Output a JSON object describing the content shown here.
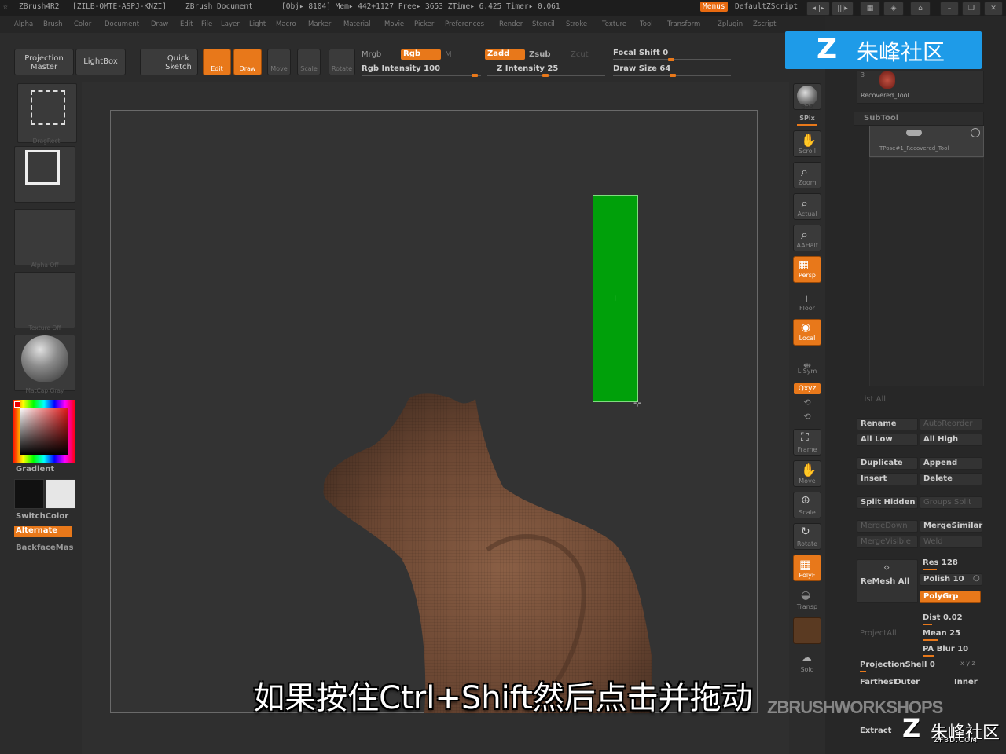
{
  "titlebar": {
    "app": "ZBrush4R2",
    "serial": "[ZILB-OMTE-ASPJ-KNZI]",
    "doc": "ZBrush Document",
    "stats": "[Obj▸ 8104] Mem▸ 442+1127  Free▸ 3653  ZTime▸ 6.425  Timer▸ 0.061",
    "menus_btn": "Menus",
    "script": "DefaultZScript"
  },
  "menubar": [
    "Alpha",
    "Brush",
    "Color",
    "Document",
    "Draw",
    "Edit",
    "File",
    "Layer",
    "Light",
    "Macro",
    "Marker",
    "Material",
    "Movie",
    "Picker",
    "Preferences",
    "Render",
    "Stencil",
    "Stroke",
    "Texture",
    "Tool",
    "Transform",
    "Zplugin",
    "Zscript"
  ],
  "toolbar": {
    "projection_master": [
      "Projection",
      "Master"
    ],
    "lightbox": "LightBox",
    "quick_sketch": [
      "Quick",
      "Sketch"
    ],
    "edit": "Edit",
    "draw": "Draw",
    "move": "Move",
    "scale": "Scale",
    "rotate": "Rotate",
    "mrgb": "Mrgb",
    "rgb": "Rgb",
    "m": "M",
    "rgb_intensity": "Rgb Intensity 100",
    "zadd": "Zadd",
    "zsub": "Zsub",
    "zcut": "Zcut",
    "z_intensity": "Z Intensity 25",
    "focal_shift": "Focal Shift 0",
    "draw_size": "Draw Size 64"
  },
  "leftpanel": {
    "stroke_label": "DragRect",
    "alpha_label": "Alpha Off",
    "texture_label": "Texture Off",
    "material_label": "MatCap Gray",
    "gradient": "Gradient",
    "switchcolor": "SwitchColor",
    "alternate": "Alternate",
    "backface": "BackfaceMas"
  },
  "shelf": {
    "bpr": "BPR",
    "spix": "SPix",
    "scroll": "Scroll",
    "zoom": "Zoom",
    "actual": "Actual",
    "aahalf": "AAHalf",
    "persp": "Persp",
    "floor": "Floor",
    "local": "Local",
    "lsym": "L.Sym",
    "xyz": "Qxyz",
    "frame": "Frame",
    "move": "Move",
    "scale": "Scale",
    "rotate": "Rotate",
    "polyf": "PolyF",
    "transp": "Transp",
    "solo": "Solo"
  },
  "toolpanel": {
    "recovered_tool": "Recovered_Tool",
    "tool_index": "3",
    "subtool_title": "SubTool",
    "subtool_item": "TPose#1_Recovered_Tool",
    "list_all": "List All",
    "rename": "Rename",
    "auto_reorder": "AutoReorder",
    "all_low": "All Low",
    "all_high": "All High",
    "duplicate": "Duplicate",
    "append": "Append",
    "insert": "Insert",
    "delete": "Delete",
    "split_hidden": "Split Hidden",
    "groups_split": "Groups Split",
    "merge_down": "MergeDown",
    "merge_similar": "MergeSimilar",
    "merge_visible": "MergeVisible",
    "weld": "Weld",
    "remesh_all": "ReMesh All",
    "res": "Res 128",
    "polish": "Polish 10",
    "polygrp": "PolyGrp",
    "project_all": "ProjectAll",
    "dist": "Dist 0.02",
    "mean": "Mean 25",
    "pa_blur": "PA Blur 10",
    "projection_shell": "ProjectionShell 0",
    "farthest": "Farthest",
    "outer": "Outer",
    "inner": "Inner",
    "extract": "Extract"
  },
  "overlay": {
    "subtitle": "如果按住Ctrl+Shift然后点击并拖动",
    "workshops": "ZBRUSHWORKSHOPS",
    "logo_text": "朱峰社区",
    "br_logo": "朱峰社区",
    "br_url": "ZF3D.COM"
  },
  "colors": {
    "accent": "#e8781a",
    "green_rect": "#00a00a",
    "model": "#6e4a36"
  }
}
